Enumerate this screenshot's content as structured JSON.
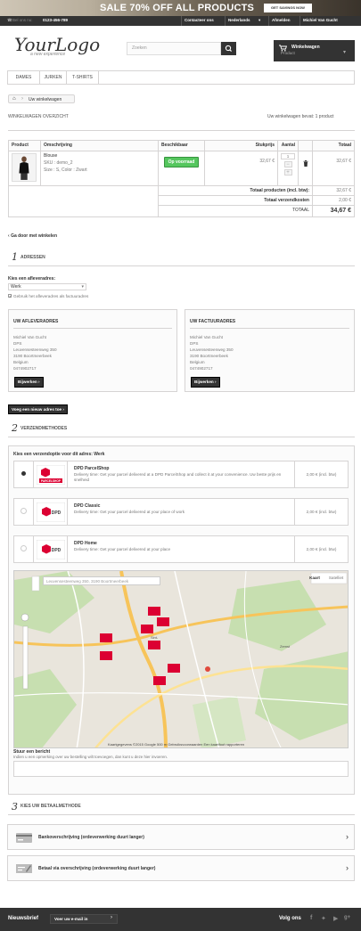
{
  "promo": {
    "text": "SALE 70% OFF ALL PRODUCTS",
    "button": "GET SAVINGS NOW"
  },
  "topbar": {
    "call_label": "Bel ons nu:",
    "phone": "0123-456-789",
    "links": [
      "Contacteer ons",
      "Nederlands",
      "Afmelden",
      "Michiel Van Gucht"
    ]
  },
  "logo": {
    "main": "YourLogo",
    "sub": "a new experience"
  },
  "search": {
    "placeholder": "Zoeken"
  },
  "cart": {
    "label": "Winkelwagen",
    "sub": "Product"
  },
  "nav": {
    "tabs": [
      "DAMES",
      "JURKEN",
      "T-SHIRTS"
    ]
  },
  "breadcrumb": {
    "current": "Uw winkelwagen"
  },
  "overview": {
    "title": "WINKELWAGEN OVERZICHT",
    "contains": "Uw winkelwagen bevat: 1 product"
  },
  "table": {
    "headers": [
      "Product",
      "Omschrijving",
      "Beschikbaar",
      "Stukprijs",
      "Aantal",
      "Totaal"
    ],
    "row": {
      "name": "Blouse",
      "sku": "SKU : demo_2",
      "attrs": "Size : S, Color : Zwart",
      "availability": "Op voorraad",
      "unit_price": "32,67 €",
      "qty": "1",
      "total": "32,67 €"
    },
    "totals": [
      {
        "label": "Totaal producten (incl. btw):",
        "value": "32,67 €"
      },
      {
        "label": "Totaal verzendkosten",
        "value": "2,00 €"
      },
      {
        "label": "TOTAAL",
        "value": "34,67 €"
      }
    ]
  },
  "continue": "Ga door met winkelen",
  "step1": {
    "num": "1",
    "title": "ADRESSEN"
  },
  "address_select": {
    "label": "Kies een afleveradres:",
    "value": "Werk",
    "checkbox": "Gebruik het afleveradres als factuuradres"
  },
  "delivery_box": {
    "title": "UW AFLEVERADRES",
    "lines": [
      "Michiel Van Gucht",
      "DPS",
      "Leuvensesteenweg 350",
      "3190 Boortmeerbeek",
      "Belgium",
      "0474902717"
    ],
    "button": "Bijwerken"
  },
  "invoice_box": {
    "title": "UW FACTUURADRES",
    "lines": [
      "Michiel Van Gucht",
      "DPS",
      "Leuvensesteenweg 350",
      "3190 Boortmeerbeek",
      "Belgium",
      "0474902717"
    ],
    "button": "Bijwerken"
  },
  "new_address": "Voeg een nieuw adres toe",
  "step2": {
    "num": "2",
    "title": "VERZENDMETHODES"
  },
  "carrier_heading": "Kies een verzendoptie voor dit adres: Werk",
  "carriers": [
    {
      "name": "DPD ParcelShop",
      "desc": "Delivery time: Get your parcel delivered at a DPD ParcelShop and collect it at your convenience. Uw beste prijs en snelheid",
      "price": "2,00 € (incl. btw)",
      "logo_text": "PARCELSHOP"
    },
    {
      "name": "DPD Classic",
      "desc": "Delivery time: Get your parcel delivered at your place of work",
      "price": "2,00 € (incl. btw)",
      "logo_text": "DPD"
    },
    {
      "name": "DPD Home",
      "desc": "Delivery time: Get your parcel delivered at your place",
      "price": "2,00 € (incl. btw)",
      "logo_text": "DPD"
    }
  ],
  "map": {
    "address": "Leuvensesteenweg 350, 3190 Boortmeerbeek",
    "map_btn": "Kaart",
    "sat_btn": "Satelliet",
    "attribution": "Kaartgegevens ©2015 Google   500 m     Gebruiksvoorwaarden   Een kaartfout rapporteren",
    "town1": "Sint-",
    "town2": "Zemst"
  },
  "message": {
    "label": "Stuur een bericht",
    "hint": "Indien u een opmerking over uw bestelling wilt toevoegen, dan kunt u deze hier invoeren."
  },
  "step3": {
    "num": "3",
    "title": "KIES UW BETAALMETHODE"
  },
  "payments": [
    "Bankoverschrijving (ordeverwerking duurt langer)",
    "Betaal via overschrijving (ordeverwerking duurt langer)"
  ],
  "footer": {
    "newsletter": "Nieuwsbrief",
    "email_placeholder": "Voer uw e-mail in",
    "follow": "Volg ons"
  }
}
